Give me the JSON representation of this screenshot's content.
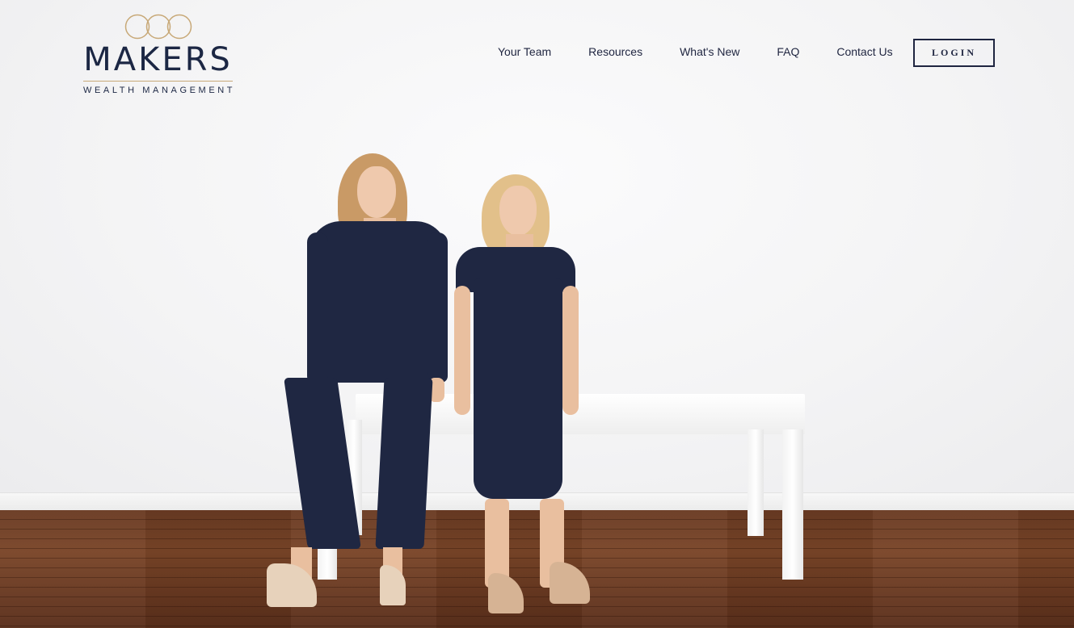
{
  "brand": {
    "name": "MAKERS",
    "tagline": "WEALTH MANAGEMENT",
    "logo_icon": "three-rings-icon",
    "ring_color": "#c8a978",
    "text_color": "#1c2744"
  },
  "nav": {
    "items": [
      {
        "label": "Your Team"
      },
      {
        "label": "Resources"
      },
      {
        "label": "What's New"
      },
      {
        "label": "FAQ"
      },
      {
        "label": "Contact Us"
      }
    ],
    "login_label": "LOGIN"
  },
  "hero": {
    "image_icon": "team-photo-two-advisors"
  }
}
